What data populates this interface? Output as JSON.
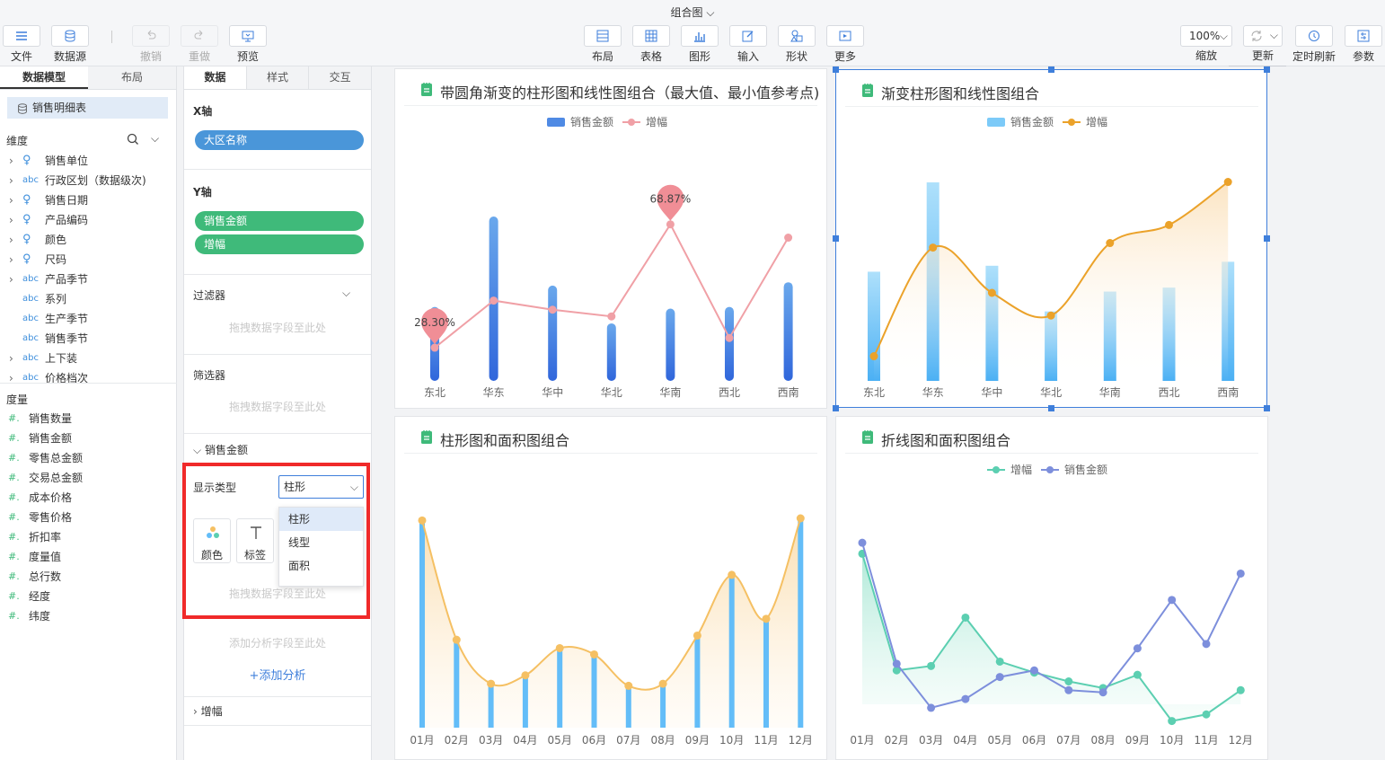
{
  "app": {
    "title": "组合图"
  },
  "toolbar": {
    "file": "文件",
    "datasource": "数据源",
    "undo": "撤销",
    "redo": "重做",
    "preview": "预览",
    "layout": "布局",
    "table": "表格",
    "chart": "图形",
    "input": "输入",
    "shape": "形状",
    "more": "更多",
    "zoom_value": "100%",
    "zoom_label": "缩放",
    "update": "更新",
    "scheduled_refresh": "定时刷新",
    "params": "参数"
  },
  "left_panel": {
    "tabs": [
      "数据模型",
      "布局"
    ],
    "dataset": "销售明细表",
    "dimensions_label": "维度",
    "dimensions": [
      {
        "name": "销售单位",
        "icon": "geo-icon",
        "expandable": true
      },
      {
        "name": "行政区划（数据级次)",
        "icon": "abc",
        "expandable": true
      },
      {
        "name": "销售日期",
        "icon": "geo-icon",
        "expandable": true
      },
      {
        "name": "产品编码",
        "icon": "geo-icon",
        "expandable": true
      },
      {
        "name": "颜色",
        "icon": "geo-icon",
        "expandable": true
      },
      {
        "name": "尺码",
        "icon": "geo-icon",
        "expandable": true
      },
      {
        "name": "产品季节",
        "icon": "abc",
        "expandable": true
      },
      {
        "name": "系列",
        "icon": "abc",
        "expandable": false
      },
      {
        "name": "生产季节",
        "icon": "abc",
        "expandable": false
      },
      {
        "name": "销售季节",
        "icon": "abc",
        "expandable": false
      },
      {
        "name": "上下装",
        "icon": "abc",
        "expandable": true
      },
      {
        "name": "价格档次",
        "icon": "abc",
        "expandable": true
      }
    ],
    "measures_label": "度量",
    "measures": [
      "销售数量",
      "销售金额",
      "零售总金额",
      "交易总金额",
      "成本价格",
      "零售价格",
      "折扣率",
      "度量值",
      "总行数",
      "经度",
      "纬度"
    ]
  },
  "data_panel": {
    "tabs": [
      "数据",
      "样式",
      "交互"
    ],
    "x_axis_label": "X轴",
    "x_fields": [
      "大区名称"
    ],
    "y_axis_label": "Y轴",
    "y_fields": [
      "销售金额",
      "增幅"
    ],
    "filter_label": "过滤器",
    "drop_hint": "拖拽数据字段至此处",
    "selector_label": "筛选器",
    "section_sales": "销售金额",
    "display_type_label": "显示类型",
    "display_type_value": "柱形",
    "display_type_options": [
      "柱形",
      "线型",
      "面积"
    ],
    "color_label": "颜色",
    "tag_label": "标签",
    "analysis_hint": "添加分析字段至此处",
    "add_analysis": "添加分析",
    "section_growth": "增幅"
  },
  "charts": {
    "c1": {
      "title": "带圆角渐变的柱形图和线性图组合（最大值、最小值参考点)",
      "legend": [
        "销售金额",
        "增幅"
      ],
      "max_label": "68.87%",
      "min_label": "28.30%"
    },
    "c2": {
      "title": "渐变柱形图和线性图组合",
      "legend": [
        "销售金额",
        "增幅"
      ]
    },
    "c3": {
      "title": "柱形图和面积图组合"
    },
    "c4": {
      "title": "折线图和面积图组合",
      "legend": [
        "增幅",
        "销售金额"
      ]
    }
  },
  "chart_data": [
    {
      "type": "bar",
      "title": "带圆角渐变的柱形图和线性图组合（最大值、最小值参考点)",
      "categories": [
        "东北",
        "华东",
        "华中",
        "华北",
        "华南",
        "西北",
        "西南"
      ],
      "series": [
        {
          "name": "销售金额",
          "kind": "bar",
          "values": [
            45,
            100,
            58,
            35,
            44,
            45,
            60
          ]
        },
        {
          "name": "增幅",
          "kind": "line",
          "values": [
            28.3,
            43.8,
            40.8,
            38.6,
            68.87,
            31.5,
            64.5
          ]
        }
      ],
      "markers": {
        "max": "68.87%",
        "min": "28.30%"
      },
      "colors": {
        "bar": "#3b74e0",
        "line": "#f0a0a6"
      }
    },
    {
      "type": "bar",
      "title": "渐变柱形图和线性图组合",
      "categories": [
        "东北",
        "华东",
        "华中",
        "华北",
        "华南",
        "西北",
        "西南"
      ],
      "series": [
        {
          "name": "销售金额",
          "kind": "bar",
          "values": [
            55,
            100,
            58,
            35,
            45,
            47,
            60
          ]
        },
        {
          "name": "增幅",
          "kind": "area-line",
          "values": [
            22,
            70,
            50,
            40,
            72,
            80,
            99
          ]
        }
      ],
      "colors": {
        "bar": "#5db4f5",
        "line": "#eba22a"
      }
    },
    {
      "type": "bar",
      "title": "柱形图和面积图组合",
      "categories": [
        "01月",
        "02月",
        "03月",
        "04月",
        "05月",
        "06月",
        "07月",
        "08月",
        "09月",
        "10月",
        "11月",
        "12月"
      ],
      "series": [
        {
          "kind": "bar",
          "values": [
            99,
            42,
            21,
            25,
            38,
            35,
            20,
            21,
            44,
            73,
            52,
            100
          ]
        },
        {
          "kind": "area",
          "values": [
            99,
            42,
            21,
            25,
            38,
            35,
            20,
            21,
            44,
            73,
            52,
            100
          ]
        }
      ],
      "colors": {
        "bar": "#63bdf8",
        "area": "#f5c063"
      }
    },
    {
      "type": "line",
      "title": "折线图和面积图组合",
      "categories": [
        "01月",
        "02月",
        "03月",
        "04月",
        "05月",
        "06月",
        "07月",
        "08月",
        "09月",
        "10月",
        "11月",
        "12月"
      ],
      "series": [
        {
          "name": "增幅",
          "kind": "area",
          "values": [
            88,
            35,
            37,
            59,
            39,
            34,
            30,
            27,
            33,
            12,
            15,
            26
          ]
        },
        {
          "name": "销售金额",
          "kind": "line",
          "values": [
            93,
            38,
            18,
            22,
            32,
            35,
            26,
            25,
            45,
            67,
            47,
            79
          ]
        }
      ],
      "colors": {
        "area": "#5ccfb1",
        "line": "#7d8fdc"
      }
    }
  ]
}
